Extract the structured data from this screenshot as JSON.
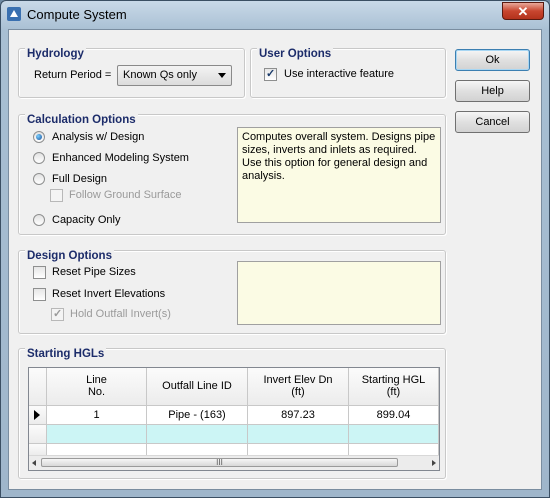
{
  "window": {
    "title": "Compute System",
    "close_label": "✕"
  },
  "buttons": {
    "ok": "Ok",
    "help": "Help",
    "cancel": "Cancel"
  },
  "hydrology": {
    "title": "Hydrology",
    "return_period_label": "Return Period =",
    "return_period_value": "Known Qs only"
  },
  "user_options": {
    "title": "User Options",
    "interactive_label": "Use interactive feature",
    "interactive_checked": true
  },
  "calculation_options": {
    "title": "Calculation Options",
    "options": [
      {
        "label": "Analysis w/ Design",
        "selected": true
      },
      {
        "label": "Enhanced Modeling System",
        "selected": false
      },
      {
        "label": "Full Design",
        "selected": false
      },
      {
        "label": "Capacity Only",
        "selected": false
      }
    ],
    "follow_ground_label": "Follow Ground Surface",
    "description": "Computes overall system. Designs pipe sizes, inverts and inlets as required. Use this option for general design and analysis."
  },
  "design_options": {
    "title": "Design Options",
    "reset_pipe_sizes": "Reset Pipe Sizes",
    "reset_invert_elevations": "Reset Invert Elevations",
    "hold_outfall_inverts": "Hold Outfall Invert(s)"
  },
  "starting_hgls": {
    "title": "Starting HGLs",
    "columns": [
      {
        "line1": "Line",
        "line2": "No."
      },
      {
        "line1": "Outfall Line ID",
        "line2": ""
      },
      {
        "line1": "Invert Elev Dn",
        "line2": "(ft)"
      },
      {
        "line1": "Starting HGL",
        "line2": "(ft)"
      }
    ],
    "rows": [
      {
        "line_no": "1",
        "outfall_id": "Pipe - (163)",
        "invert_elev": "897.23",
        "starting_hgl": "899.04"
      }
    ],
    "scroll_grip": "III"
  }
}
